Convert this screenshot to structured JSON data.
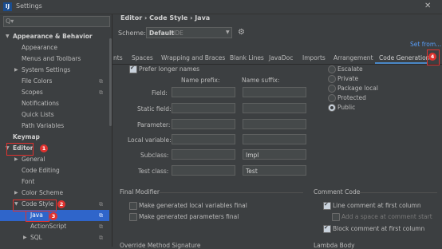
{
  "window": {
    "title": "Settings",
    "app_icon": "IJ"
  },
  "search": {
    "placeholder": "Q▾"
  },
  "sidebar": {
    "items": [
      {
        "label": "Appearance & Behavior"
      },
      {
        "label": "Appearance"
      },
      {
        "label": "Menus and Toolbars"
      },
      {
        "label": "System Settings"
      },
      {
        "label": "File Colors"
      },
      {
        "label": "Scopes"
      },
      {
        "label": "Notifications"
      },
      {
        "label": "Quick Lists"
      },
      {
        "label": "Path Variables"
      },
      {
        "label": "Keymap"
      },
      {
        "label": "Editor"
      },
      {
        "label": "General"
      },
      {
        "label": "Code Editing"
      },
      {
        "label": "Font"
      },
      {
        "label": "Color Scheme"
      },
      {
        "label": "Code Style"
      },
      {
        "label": "Java"
      },
      {
        "label": "ActionScript"
      },
      {
        "label": "SQL"
      }
    ]
  },
  "badges": {
    "b1": "1",
    "b2": "2",
    "b3": "3",
    "b4": "4"
  },
  "breadcrumb": "Editor  ›  Code Style  ›  Java",
  "scheme": {
    "label": "Scheme:",
    "value": "Default",
    "suffix": "IDE"
  },
  "set_from": "Set from...",
  "tabs": [
    "nts",
    "Spaces",
    "Wrapping and Braces",
    "Blank Lines",
    "JavaDoc",
    "Imports",
    "Arrangement",
    "Code Generation"
  ],
  "naming": {
    "prefer_longer": "Prefer longer names",
    "prefix_header": "Name prefix:",
    "suffix_header": "Name suffix:",
    "rows": [
      {
        "label": "Field:",
        "prefix": "",
        "suffix": ""
      },
      {
        "label": "Static field:",
        "prefix": "",
        "suffix": ""
      },
      {
        "label": "Parameter:",
        "prefix": "",
        "suffix": ""
      },
      {
        "label": "Local variable:",
        "prefix": "",
        "suffix": ""
      },
      {
        "label": "Subclass:",
        "prefix": "",
        "suffix": "Impl"
      },
      {
        "label": "Test class:",
        "prefix": "",
        "suffix": "Test"
      }
    ]
  },
  "visibility": {
    "options": [
      "Escalate",
      "Private",
      "Package local",
      "Protected",
      "Public"
    ],
    "selected": "Public"
  },
  "final_modifier": {
    "title": "Final Modifier",
    "local_vars": "Make generated local variables final",
    "params": "Make generated parameters final"
  },
  "comment_code": {
    "title": "Comment Code",
    "line_first_col": "Line comment at first column",
    "add_space": "Add a space at comment start",
    "block_first_col": "Block comment at first column"
  },
  "bottom": {
    "left_title": "Override Method Signature",
    "right_title": "Lambda Body"
  }
}
